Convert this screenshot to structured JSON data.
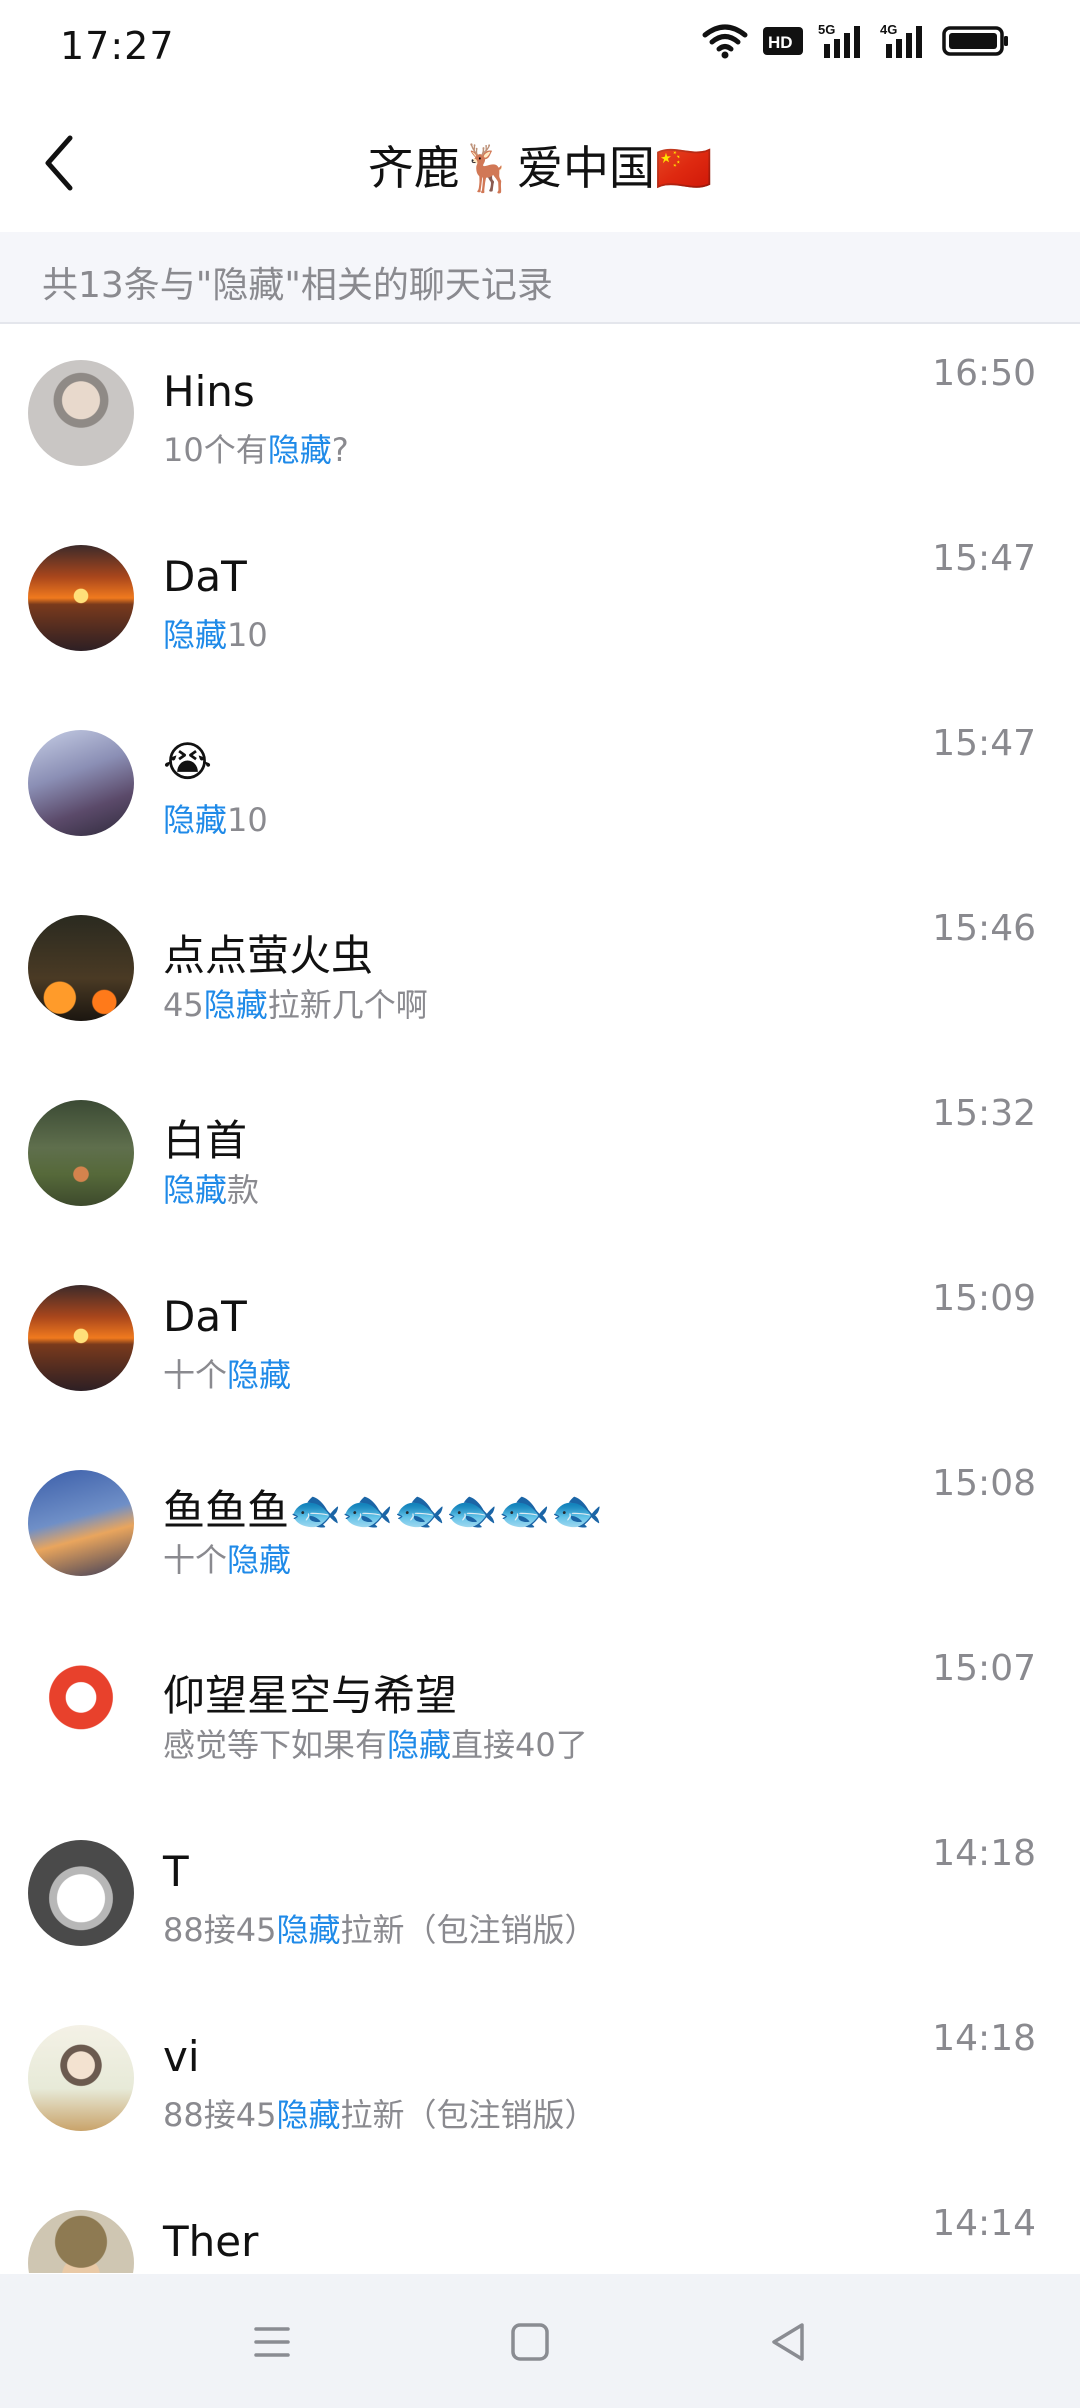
{
  "status_bar": {
    "time": "17:27",
    "icons": [
      "wifi-icon",
      "hd-icon",
      "5g-signal-icon",
      "4g-signal-icon",
      "battery-icon"
    ],
    "hd_label": "HD",
    "net_5g": "5G",
    "net_4g": "4G"
  },
  "header": {
    "back_icon": "chevron-left-icon",
    "title": "齐鹿🦌爱中国🇨🇳"
  },
  "search": {
    "summary": "共13条与\"隐藏\"相关的聊天记录",
    "keyword": "隐藏"
  },
  "results": [
    {
      "name": "Hins",
      "pre": "10个有",
      "kw": "隐藏",
      "post": "?",
      "time": "16:50",
      "avatar": "portrait-young-man"
    },
    {
      "name": "DaT",
      "pre": "",
      "kw": "隐藏",
      "post": "10",
      "time": "15:47",
      "avatar": "sunset-sea"
    },
    {
      "name": "😭",
      "pre": "",
      "kw": "隐藏",
      "post": "10",
      "time": "15:47",
      "avatar": "anime-couple"
    },
    {
      "name": "点点萤火虫",
      "pre": "45",
      "kw": "隐藏",
      "post": "拉新几个啊",
      "time": "15:46",
      "avatar": "dancer-fire"
    },
    {
      "name": "白首",
      "pre": "",
      "kw": "隐藏",
      "post": "款",
      "time": "15:32",
      "avatar": "tree-lantern"
    },
    {
      "name": "DaT",
      "pre": "十个",
      "kw": "隐藏",
      "post": "",
      "time": "15:09",
      "avatar": "sunset-sea"
    },
    {
      "name": "鱼鱼鱼🐟🐟🐟🐟🐟🐟",
      "pre": "十个",
      "kw": "隐藏",
      "post": "",
      "time": "15:08",
      "avatar": "anime-night-sky"
    },
    {
      "name": "仰望星空与希望",
      "pre": "感觉等下如果有",
      "kw": "隐藏",
      "post": "直接40了",
      "time": "15:07",
      "avatar": "cartoon-fox"
    },
    {
      "name": "T",
      "pre": "88接45",
      "kw": "隐藏",
      "post": "拉新（包注销版）",
      "time": "14:18",
      "avatar": "manga-white-hair"
    },
    {
      "name": "vi",
      "pre": "88接45",
      "kw": "隐藏",
      "post": "拉新（包注销版）",
      "time": "14:18",
      "avatar": "watercolor-boy"
    },
    {
      "name": "Ther",
      "pre": "",
      "kw": "",
      "post": "",
      "time": "14:14",
      "avatar": "cap-glasses"
    }
  ],
  "nav_bar": {
    "icons": [
      "menu-icon",
      "home-square-icon",
      "back-triangle-icon"
    ]
  },
  "colors": {
    "highlight": "#1f8ae8",
    "secondary_text": "#8a8a8f",
    "summary_bg": "#f5f6fa",
    "nav_bg": "#f1f3f7"
  }
}
